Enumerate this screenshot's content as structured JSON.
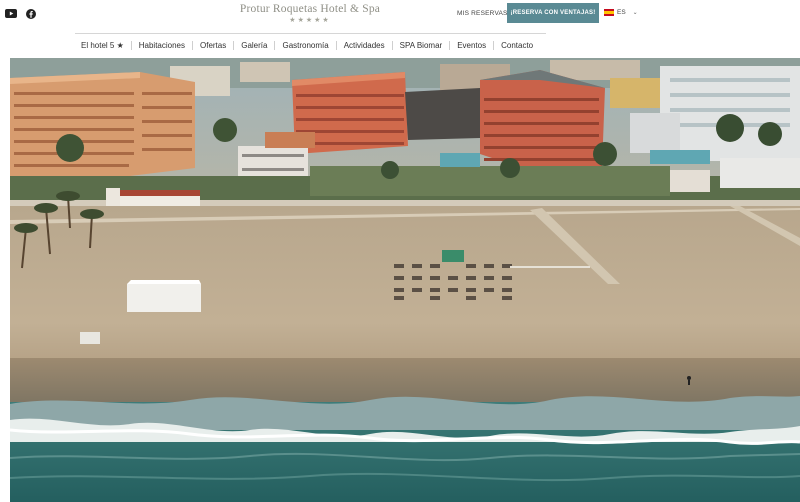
{
  "social": {
    "youtube_icon": "youtube-icon",
    "facebook_icon": "facebook-icon"
  },
  "brand": {
    "name": "Protur Roquetas Hotel & Spa",
    "stars": "★★★★★"
  },
  "top_actions": {
    "my_reservations": "MIS RESERVAS",
    "book_button": "¡RESERVA CON VENTAJAS!",
    "language": "ES",
    "language_flag": "spain-flag-icon"
  },
  "nav": {
    "items": [
      {
        "label": "El hotel 5 ★"
      },
      {
        "label": "Habitaciones"
      },
      {
        "label": "Ofertas"
      },
      {
        "label": "Galería"
      },
      {
        "label": "Gastronomía"
      },
      {
        "label": "Actividades"
      },
      {
        "label": "SPA Biomar"
      },
      {
        "label": "Eventos"
      },
      {
        "label": "Contacto"
      }
    ]
  },
  "colors": {
    "accent": "#5a8a94",
    "brand_text": "#8f8f86",
    "sand": "#c8b69c",
    "sea": "#2f6f6e"
  }
}
